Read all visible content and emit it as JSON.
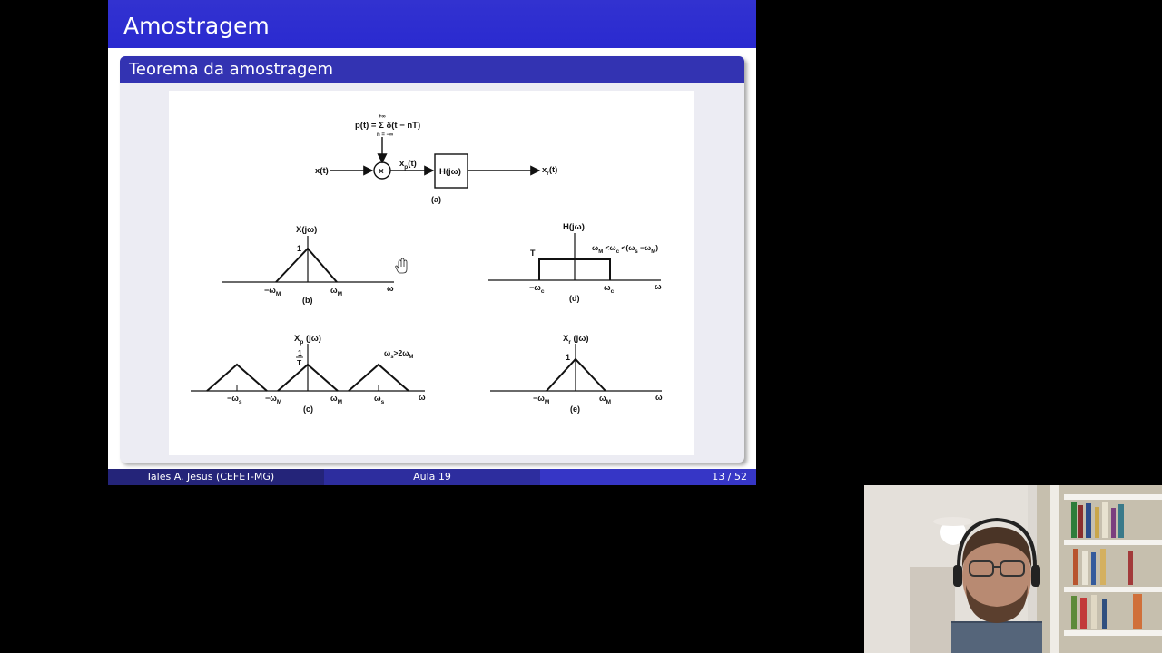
{
  "slide": {
    "frame_title": "Amostragem",
    "block_title": "Teorema da amostragem",
    "figure": {
      "panel_a": {
        "impulse_train": "p(t) = Σ δ(t − nT)",
        "sum_upper": "+∞",
        "sum_lower": "n = −∞",
        "input": "x(t)",
        "multiplier": "×",
        "sampled": "x",
        "sampled_sub": "p",
        "sampled_arg": "(t)",
        "filter": "H(jω)",
        "output": "x",
        "output_sub": "r",
        "output_arg": "(t)",
        "caption": "(a)"
      },
      "panel_b": {
        "title": "X(jω)",
        "peak": "1",
        "neg": "−ω",
        "neg_sub": "M",
        "pos": "ω",
        "pos_sub": "M",
        "axis": "ω",
        "caption": "(b)"
      },
      "panel_c": {
        "title_main": "X",
        "title_sub": "p",
        "title_arg": " (jω)",
        "peak_num": "1",
        "peak_den": "T",
        "cond": "ω",
        "cond_sub": "s",
        "cond_rest": ">2ω",
        "cond_sub2": "M",
        "ticks": [
          "−ω",
          "−ω",
          "ω",
          "ω"
        ],
        "tick_subs": [
          "s",
          "M",
          "M",
          "s"
        ],
        "axis": "ω",
        "caption": "(c)"
      },
      "panel_d": {
        "title": "H(jω)",
        "height": "T",
        "cond": "ω",
        "cond_sub": "M",
        "cond_mid": " <ω",
        "cond_sub2": "c",
        "cond_rest": " <(ω",
        "cond_sub3": "s",
        "cond_end": " −ω",
        "cond_sub4": "M",
        "cond_close": ")",
        "neg": "−ω",
        "neg_sub": "c",
        "pos": "ω",
        "pos_sub": "c",
        "axis": "ω",
        "caption": "(d)"
      },
      "panel_e": {
        "title_main": "X",
        "title_sub": "r",
        "title_arg": " (jω)",
        "peak": "1",
        "neg": "−ω",
        "neg_sub": "M",
        "pos": "ω",
        "pos_sub": "M",
        "axis": "ω",
        "caption": "(e)"
      }
    },
    "footer": {
      "author": "Tales A. Jesus  (CEFET-MG)",
      "title": "Aula 19",
      "page": "13 / 52"
    }
  },
  "colors": {
    "frame_title_bg": "#2a2ad0",
    "block_title_bg": "#3333b2",
    "block_body_bg": "#ececf3",
    "footer_left": "#242479",
    "footer_center": "#2d2d9e",
    "footer_right": "#3636c6"
  },
  "webcam": {
    "description_icon": "presenter-video-icon"
  }
}
